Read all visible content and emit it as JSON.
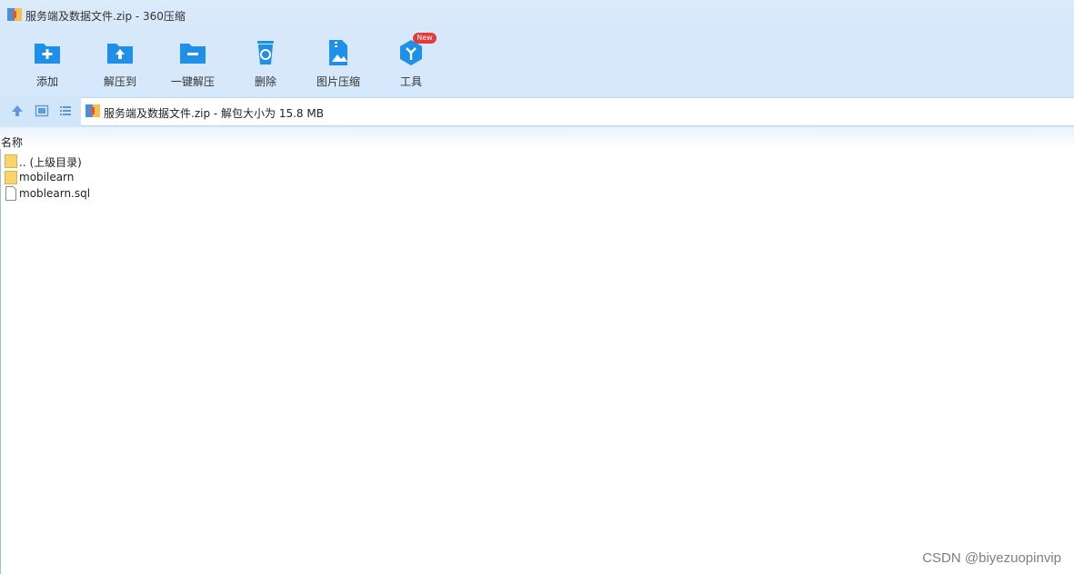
{
  "window": {
    "title": "服务端及数据文件.zip - 360压缩"
  },
  "toolbar": {
    "items": [
      {
        "label": "添加",
        "icon": "add-folder-icon"
      },
      {
        "label": "解压到",
        "icon": "extract-to-icon"
      },
      {
        "label": "一键解压",
        "icon": "one-click-extract-icon"
      },
      {
        "label": "删除",
        "icon": "recycle-bin-icon"
      },
      {
        "label": "图片压缩",
        "icon": "image-compress-icon"
      },
      {
        "label": "工具",
        "icon": "tools-icon",
        "badge": "New"
      }
    ]
  },
  "navbar": {
    "address_text": "服务端及数据文件.zip - 解包大小为 15.8 MB"
  },
  "filelist": {
    "column_header": "名称",
    "rows": [
      {
        "name": ".. (上级目录)",
        "type": "folder"
      },
      {
        "name": "mobilearn",
        "type": "folder"
      },
      {
        "name": "moblearn.sql",
        "type": "file"
      }
    ]
  },
  "watermark": "CSDN @biyezuopinvip",
  "colors": {
    "accent": "#1e90e8",
    "toolbar_bg": "#d7e8fa",
    "folder": "#f7d56b"
  }
}
